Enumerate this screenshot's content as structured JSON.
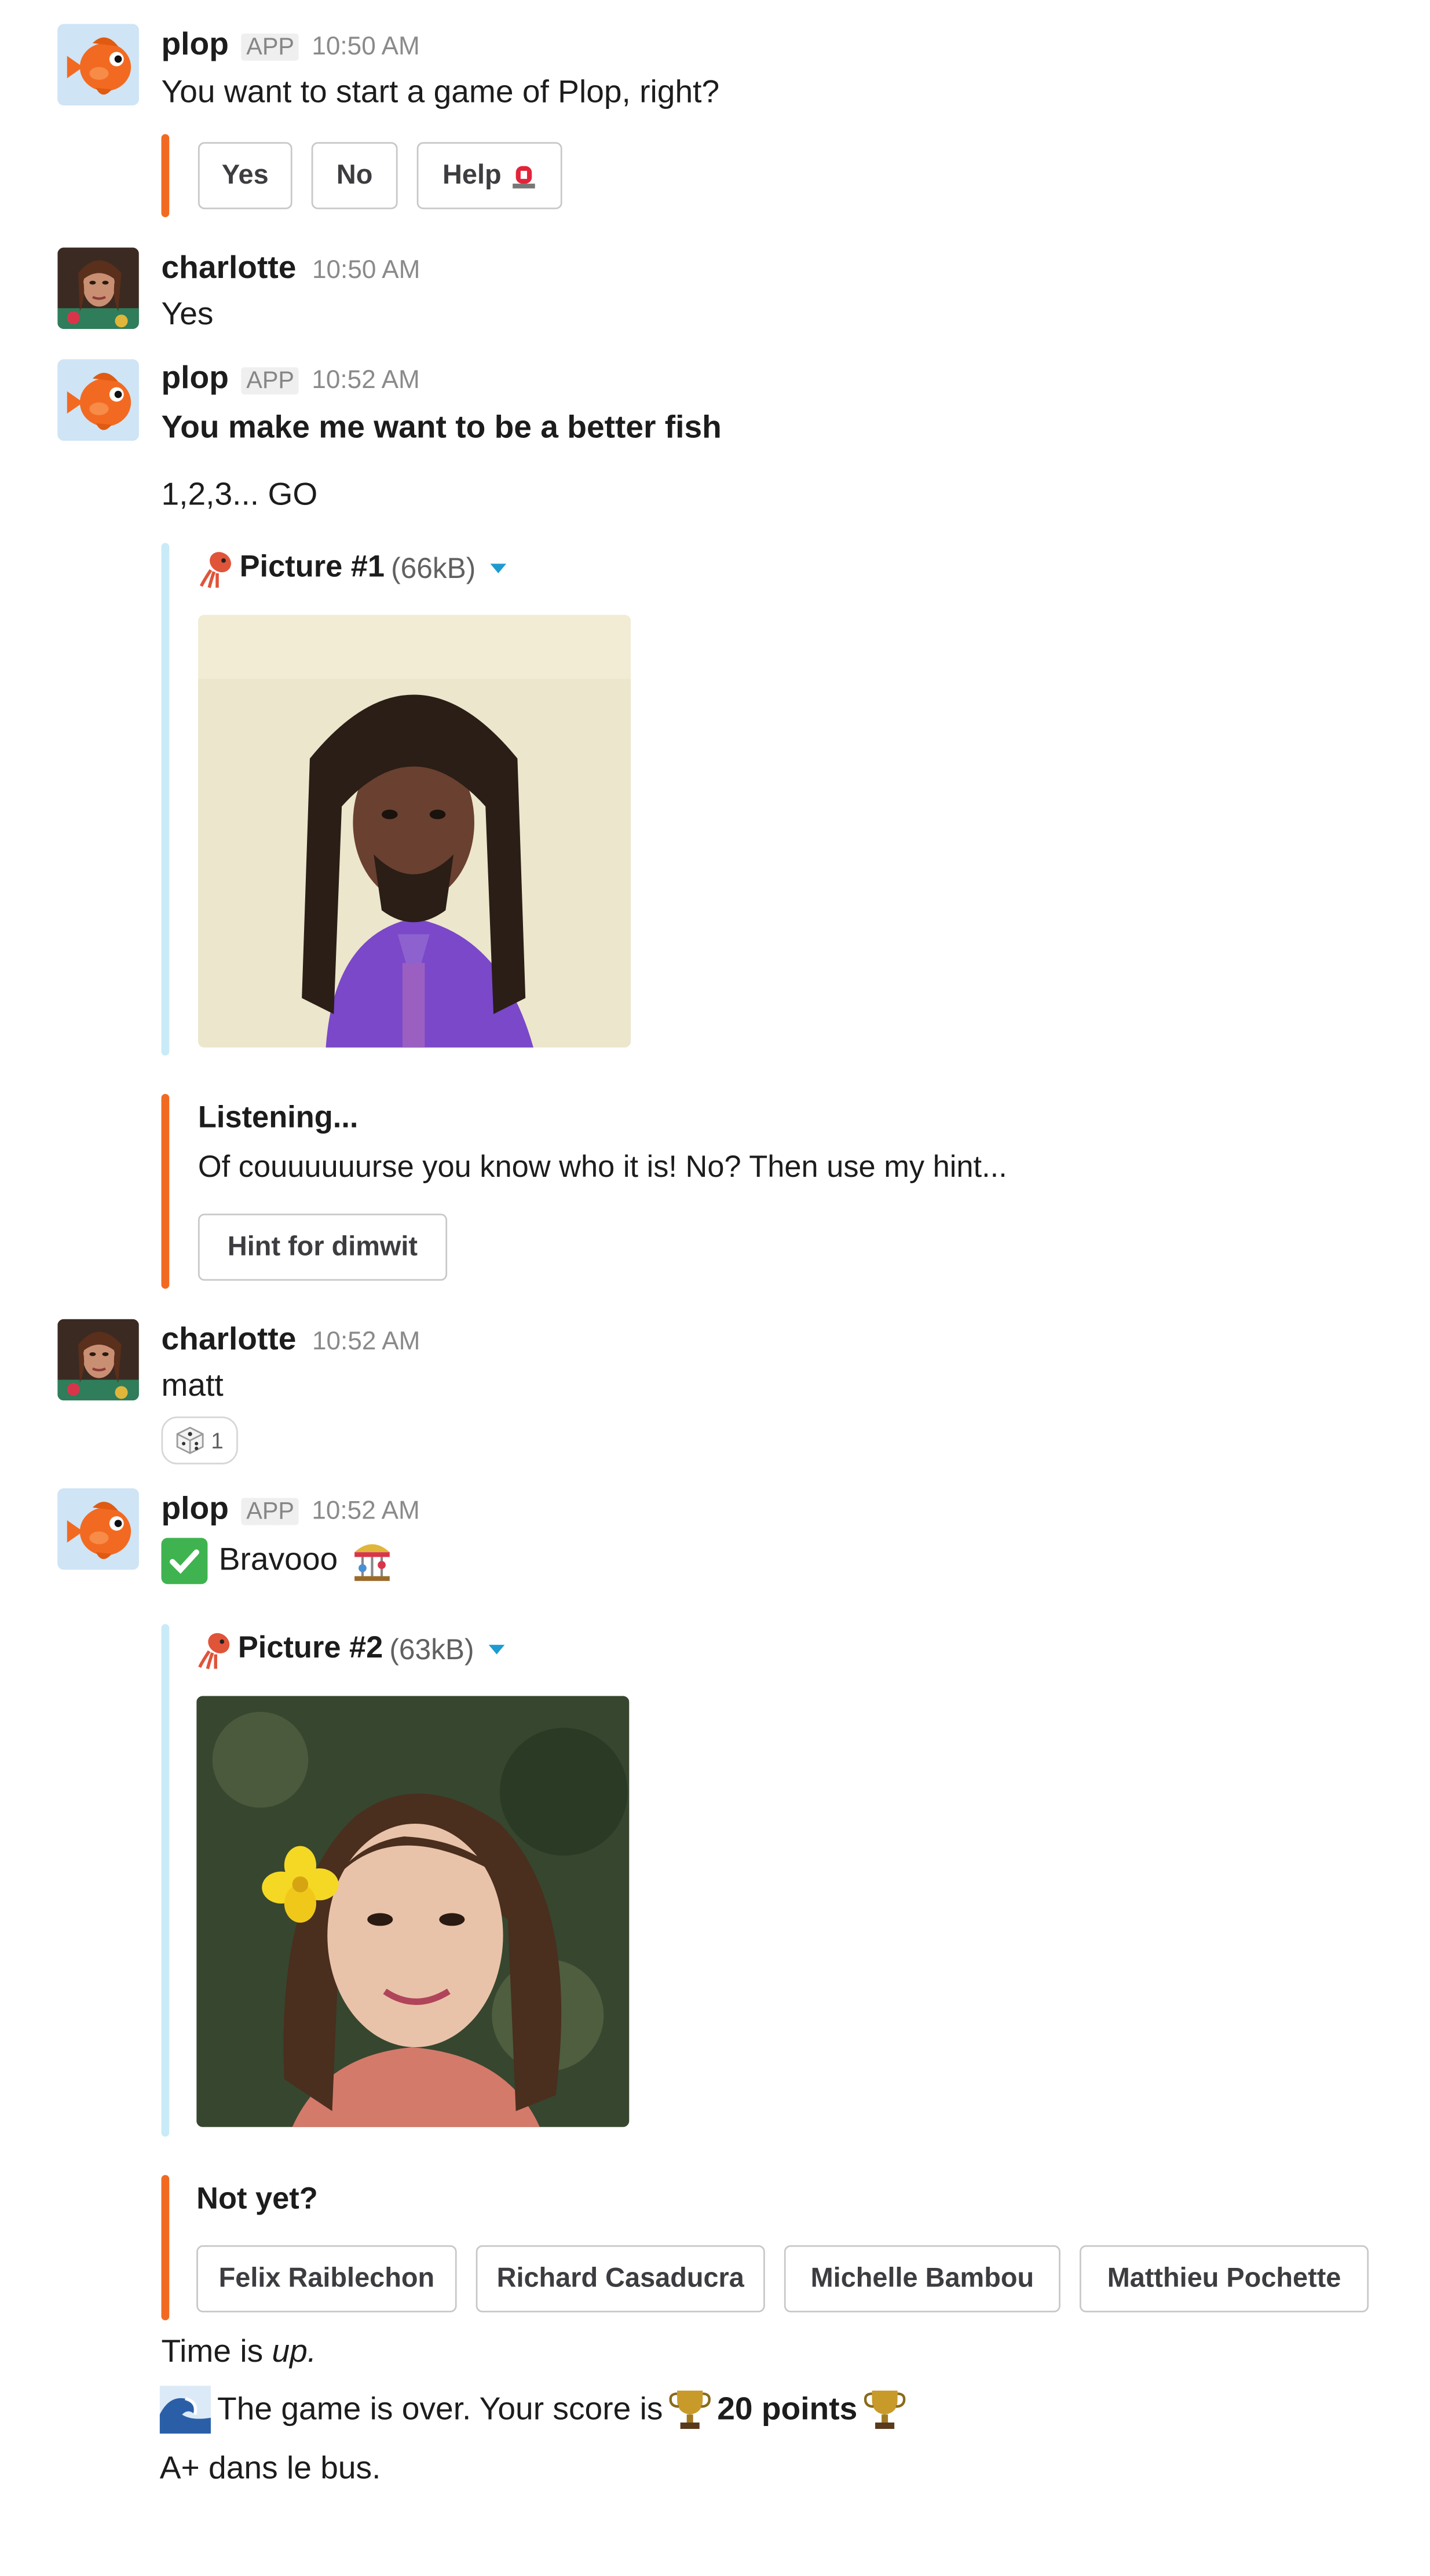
{
  "messages": {
    "m1": {
      "name": "plop",
      "badge": "APP",
      "time": "10:50 AM",
      "text": "You want to start a game of Plop, right?",
      "buttons": [
        "Yes",
        "No",
        "Help"
      ]
    },
    "m2": {
      "name": "charlotte",
      "time": "10:50 AM",
      "text": "Yes"
    },
    "m3": {
      "name": "plop",
      "badge": "APP",
      "time": "10:52 AM",
      "headline": "You make me want to be a better fish",
      "countdown": "1,2,3... GO",
      "picture_title": "Picture #1",
      "picture_size": "(66kB)",
      "listening_title": "Listening...",
      "listening_text": "Of couuuuuurse you know who it is! No? Then use my hint...",
      "hint_button": "Hint for dimwit"
    },
    "m4": {
      "name": "charlotte",
      "time": "10:52 AM",
      "text": "matt",
      "reaction_count": "1"
    },
    "m5": {
      "name": "plop",
      "badge": "APP",
      "time": "10:52 AM",
      "bravo": "Bravooo",
      "picture_title": "Picture #2",
      "picture_size": "(63kB)",
      "notyet_title": "Not yet?",
      "choices": [
        "Felix Raiblechon",
        "Richard Casaducra",
        "Michelle Bambou",
        "Matthieu Pochette"
      ],
      "time_is": "Time is ",
      "time_up": "up.",
      "game_over": "The game is over. Your score is ",
      "score": "20 points",
      "closing": "A+ dans le bus."
    }
  },
  "icons": {
    "fish_avatar": "goldfish-avatar-icon",
    "siren": "siren-emoji",
    "squid": "squid-emoji",
    "dice": "dice-emoji",
    "check": "white-check-mark-emoji",
    "carousel": "carousel-emoji",
    "wave": "wave-emoji",
    "trophy": "trophy-emoji"
  },
  "colors": {
    "accent_orange": "#f26a21",
    "attachment_blue": "#c9ebf7",
    "link_blue": "#1d9bd1",
    "check_green": "#3fb34f"
  }
}
